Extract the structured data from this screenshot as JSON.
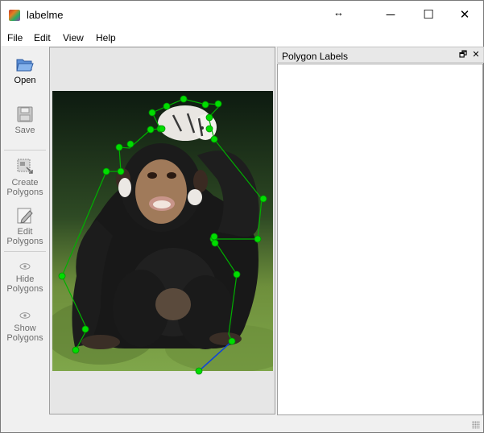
{
  "window": {
    "title": "labelme",
    "resize_glyph": "↔",
    "minimize_glyph": "─",
    "maximize_glyph": "☐",
    "close_glyph": "✕"
  },
  "menu": {
    "items": [
      {
        "label": "File"
      },
      {
        "label": "Edit"
      },
      {
        "label": "View"
      },
      {
        "label": "Help"
      }
    ]
  },
  "toolbar": {
    "tools": [
      {
        "label": "Open",
        "icon": "folder-open-icon",
        "enabled": true
      },
      {
        "label": "Save",
        "icon": "floppy-disk-icon",
        "enabled": false
      },
      {
        "label": "Create\nPolygons",
        "icon": "create-polygon-icon",
        "enabled": false
      },
      {
        "label": "Edit\nPolygons",
        "icon": "edit-pencil-icon",
        "enabled": false
      },
      {
        "label": "Hide\nPolygons",
        "icon": "eye-icon",
        "enabled": false
      },
      {
        "label": "Show\nPolygons",
        "icon": "eye-icon",
        "enabled": false
      }
    ]
  },
  "dock": {
    "title": "Polygon Labels",
    "float_glyph": "🗗",
    "close_glyph": "✕",
    "labels": []
  },
  "annotation": {
    "polygon_color": "#00c000",
    "vertex_color": "#00e000",
    "active_edge_color": "#1040e0"
  }
}
